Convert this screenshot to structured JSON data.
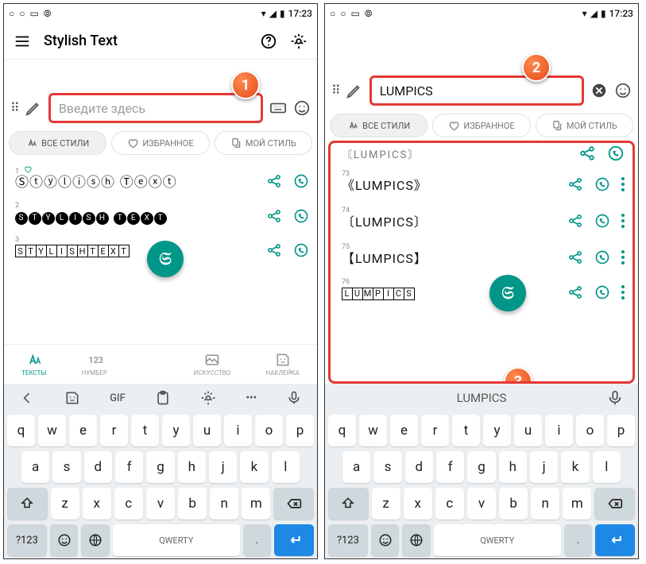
{
  "status": {
    "time": "17:23"
  },
  "header": {
    "title": "Stylish Text"
  },
  "input": {
    "placeholder": "Введите здесь",
    "value": "LUMPICS"
  },
  "tabs": {
    "all": "ВСЕ СТИЛИ",
    "fav": "ИЗБРАННОЕ",
    "my": "МОЙ СТИЛЬ"
  },
  "left_list": {
    "n1": "1",
    "t1": "Ⓢⓣⓨⓛⓘⓢⓗ Ⓣⓔⓧⓣ",
    "n2": "2",
    "n3": "3"
  },
  "right_list": {
    "n73": "73",
    "t73": "《LUMPICS》",
    "n74": "74",
    "t74": "〔LUMPICS〕",
    "n75": "75",
    "t75": "【LUMPICS】",
    "n76": "76"
  },
  "bottomnav": {
    "texts": "ТЕКСТЫ",
    "number": "НУМБЕР",
    "art": "ИСКУССТВО",
    "sticker": "НАКЛЕЙКА"
  },
  "kb": {
    "gif": "GIF",
    "suggest": "LUMPICS",
    "space": "QWERTY",
    "alt": "?123",
    "r1": {
      "k0": "q",
      "k1": "w",
      "k2": "e",
      "k3": "r",
      "k4": "t",
      "k5": "y",
      "k6": "u",
      "k7": "i",
      "k8": "o",
      "k9": "p"
    },
    "r2": {
      "k0": "a",
      "k1": "s",
      "k2": "d",
      "k3": "f",
      "k4": "g",
      "k5": "h",
      "k6": "j",
      "k7": "k",
      "k8": "l"
    },
    "r3": {
      "k0": "z",
      "k1": "x",
      "k2": "c",
      "k3": "v",
      "k4": "b",
      "k5": "n",
      "k6": "m"
    }
  },
  "callouts": {
    "one": "1",
    "two": "2",
    "three": "3"
  },
  "fab": "𝔖"
}
